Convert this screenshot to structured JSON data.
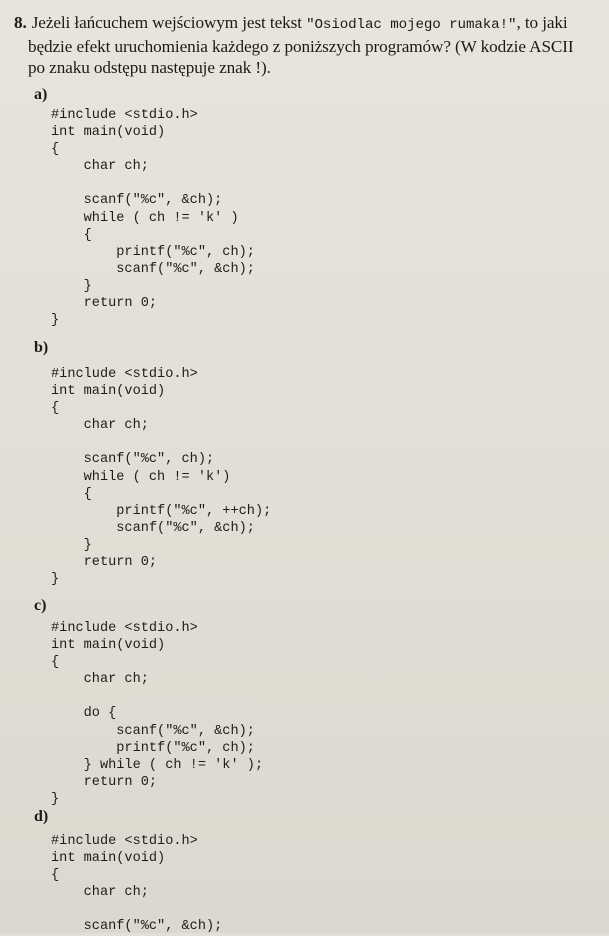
{
  "question": {
    "number": "8.",
    "line1_a": "Jeżeli łańcuchem wejściowym jest tekst",
    "line1_code": "\"Osiodlac mojego rumaka!\"",
    "line1_b": ", to jaki",
    "line2": "będzie efekt uruchomienia każdego z poniższych programów? (W kodzie ASCII",
    "line3": "po znaku odstępu następuje znak !)."
  },
  "programs": [
    {
      "label": "a)",
      "code": "#include <stdio.h>\nint main(void)\n{\n    char ch;\n\n    scanf(\"%c\", &ch);\n    while ( ch != 'k' )\n    {\n        printf(\"%c\", ch);\n        scanf(\"%c\", &ch);\n    }\n    return 0;\n}"
    },
    {
      "label": "b)",
      "code": "#include <stdio.h>\nint main(void)\n{\n    char ch;\n\n    scanf(\"%c\", ch);\n    while ( ch != 'k')\n    {\n        printf(\"%c\", ++ch);\n        scanf(\"%c\", &ch);\n    }\n    return 0;\n}"
    },
    {
      "label": "c)",
      "code": "#include <stdio.h>\nint main(void)\n{\n    char ch;\n\n    do {\n        scanf(\"%c\", &ch);\n        printf(\"%c\", ch);\n    } while ( ch != 'k' );\n    return 0;\n}"
    },
    {
      "label": "d)",
      "code": "#include <stdio.h>\nint main(void)\n{\n    char ch;\n\n    scanf(\"%c\", &ch);"
    }
  ]
}
